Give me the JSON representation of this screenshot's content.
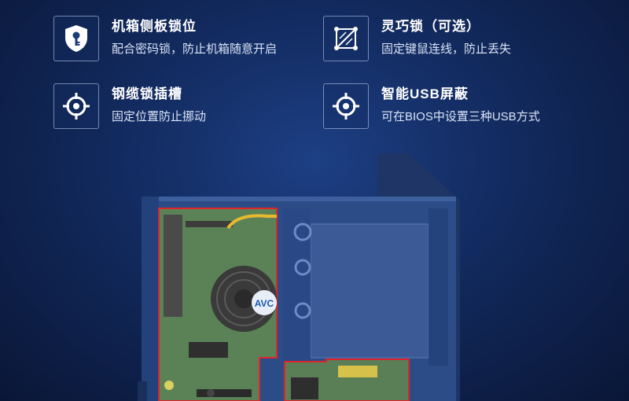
{
  "features": [
    {
      "icon": "key-shield-icon",
      "title": "机箱侧板锁位",
      "desc": "配合密码锁，防止机箱随意开启"
    },
    {
      "icon": "lock-frame-icon",
      "title": "灵巧锁（可选）",
      "desc": "固定键鼠连线，防止丢失"
    },
    {
      "icon": "crosshair-icon",
      "title": "钢缆锁插槽",
      "desc": "固定位置防止挪动"
    },
    {
      "icon": "crosshair-icon",
      "title": "智能USB屏蔽",
      "desc": "可在BIOS中设置三种USB方式"
    }
  ],
  "product_image": {
    "label": "AVC"
  },
  "colors": {
    "accent_red": "#e0242a",
    "chassis_blue": "#2a4a86",
    "board_green": "#5f8a5a"
  }
}
